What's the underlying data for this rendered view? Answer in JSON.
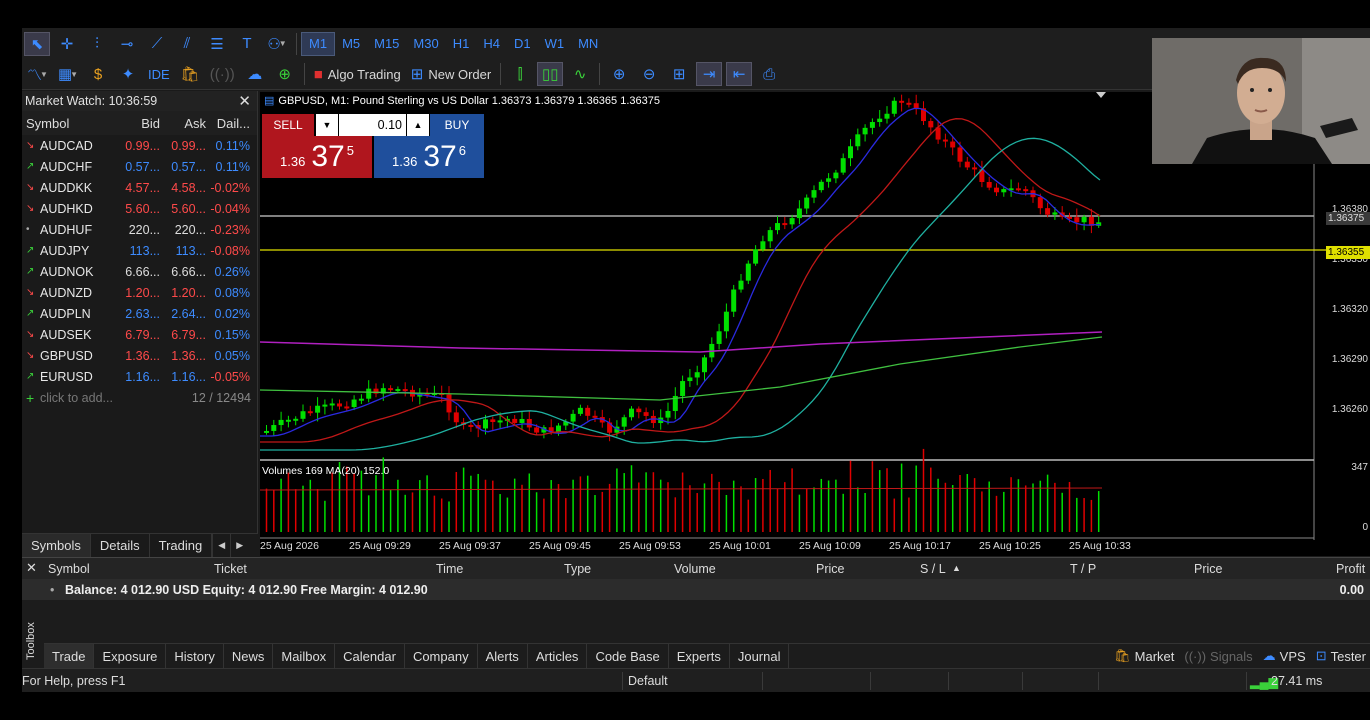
{
  "toolbar": {
    "timeframes": [
      "M1",
      "M5",
      "M15",
      "M30",
      "H1",
      "H4",
      "D1",
      "W1",
      "MN"
    ],
    "active_timeframe": "M1",
    "ide_label": "IDE",
    "algo_trading_label": "Algo Trading",
    "new_order_label": "New Order"
  },
  "market_watch": {
    "title": "Market Watch: 10:36:59",
    "columns": [
      "Symbol",
      "Bid",
      "Ask",
      "Dail..."
    ],
    "rows": [
      {
        "symbol": "AUDCAD",
        "bid": "0.99...",
        "ask": "0.99...",
        "daily": "0.11%",
        "dir": "down"
      },
      {
        "symbol": "AUDCHF",
        "bid": "0.57...",
        "ask": "0.57...",
        "daily": "0.11%",
        "dir": "up"
      },
      {
        "symbol": "AUDDKK",
        "bid": "4.57...",
        "ask": "4.58...",
        "daily": "-0.02%",
        "dir": "down"
      },
      {
        "symbol": "AUDHKD",
        "bid": "5.60...",
        "ask": "5.60...",
        "daily": "-0.04%",
        "dir": "down"
      },
      {
        "symbol": "AUDHUF",
        "bid": "220...",
        "ask": "220...",
        "daily": "-0.23%",
        "dir": "none"
      },
      {
        "symbol": "AUDJPY",
        "bid": "113...",
        "ask": "113...",
        "daily": "-0.08%",
        "dir": "up"
      },
      {
        "symbol": "AUDNOK",
        "bid": "6.66...",
        "ask": "6.66...",
        "daily": "0.26%",
        "dir": "none-up"
      },
      {
        "symbol": "AUDNZD",
        "bid": "1.20...",
        "ask": "1.20...",
        "daily": "0.08%",
        "dir": "down"
      },
      {
        "symbol": "AUDPLN",
        "bid": "2.63...",
        "ask": "2.64...",
        "daily": "0.02%",
        "dir": "up"
      },
      {
        "symbol": "AUDSEK",
        "bid": "6.79...",
        "ask": "6.79...",
        "daily": "0.15%",
        "dir": "down"
      },
      {
        "symbol": "GBPUSD",
        "bid": "1.36...",
        "ask": "1.36...",
        "daily": "0.05%",
        "dir": "down"
      },
      {
        "symbol": "EURUSD",
        "bid": "1.16...",
        "ask": "1.16...",
        "daily": "-0.05%",
        "dir": "up"
      }
    ],
    "add_label": "click to add...",
    "count": "12 / 12494",
    "tabs": [
      "Symbols",
      "Details",
      "Trading"
    ]
  },
  "chart": {
    "title": "GBPUSD, M1:  Pound Sterling vs US Dollar  1.36373 1.36379 1.36365 1.36375",
    "sell_label": "SELL",
    "buy_label": "BUY",
    "volume": "0.10",
    "sell_price": {
      "prefix": "1.36",
      "big": "37",
      "sup": "5"
    },
    "buy_price": {
      "prefix": "1.36",
      "big": "37",
      "sup": "6"
    },
    "price_axis": [
      "1.36380",
      "1.36350",
      "1.36320",
      "1.36290",
      "1.36260"
    ],
    "bid_line_label": "1.36375",
    "level_line_label": "1.36355",
    "volume_title": "Volumes 169 MA(20) 152.0",
    "volume_axis": [
      "347",
      "0"
    ],
    "time_axis": [
      "25 Aug 2026",
      "25 Aug 09:29",
      "25 Aug 09:37",
      "25 Aug 09:45",
      "25 Aug 09:53",
      "25 Aug 10:01",
      "25 Aug 10:09",
      "25 Aug 10:17",
      "25 Aug 10:25",
      "25 Aug 10:33"
    ],
    "colors": {
      "bull": "#00e000",
      "bear": "#e00000",
      "ma_fast": "#2a2ae0",
      "ma_mid": "#c01818",
      "ma_slow": "#1fb0a0",
      "ma_long": "#40c040",
      "ma_purple": "#b020c0",
      "level": "#e0e000"
    }
  },
  "toolbox": {
    "label": "Toolbox",
    "columns": [
      "Symbol",
      "Ticket",
      "Time",
      "Type",
      "Volume",
      "Price",
      "S / L",
      "T / P",
      "Price",
      "Profit"
    ],
    "balance_line": "Balance: 4 012.90 USD  Equity: 4 012.90  Free Margin: 4 012.90",
    "profit": "0.00",
    "tabs": [
      "Trade",
      "Exposure",
      "History",
      "News",
      "Mailbox",
      "Calendar",
      "Company",
      "Alerts",
      "Articles",
      "Code Base",
      "Experts",
      "Journal"
    ],
    "right_tabs": [
      "Market",
      "Signals",
      "VPS",
      "Tester"
    ]
  },
  "status": {
    "help": "For Help, press F1",
    "profile": "Default",
    "ping": "27.41 ms"
  }
}
